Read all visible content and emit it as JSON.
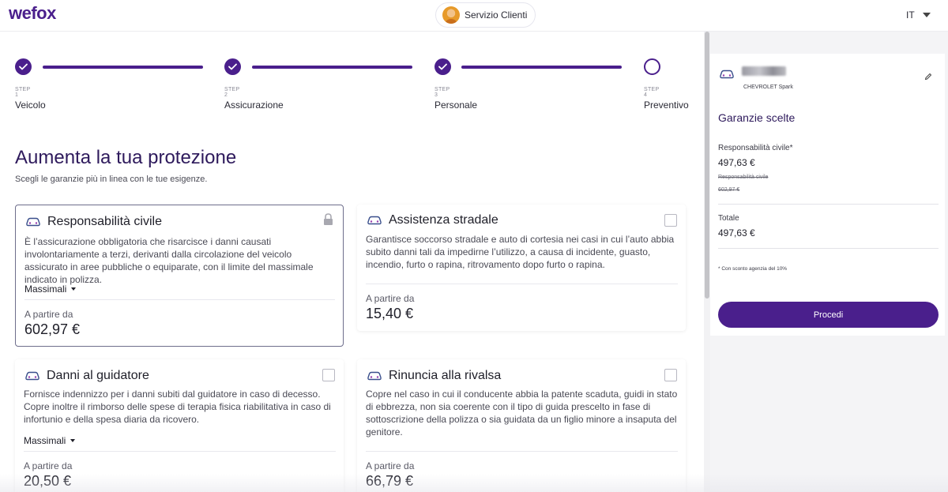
{
  "header": {
    "logo": "wefox",
    "support_label": "Servizio Clienti",
    "language": "IT"
  },
  "stepper": {
    "steps": [
      {
        "number": "STEP 1",
        "label": "Veicolo",
        "done": true
      },
      {
        "number": "STEP 2",
        "label": "Assicurazione",
        "done": true
      },
      {
        "number": "STEP 3",
        "label": "Personale",
        "done": true
      },
      {
        "number": "STEP 4",
        "label": "Preventivo",
        "done": false
      }
    ]
  },
  "main": {
    "title": "Aumenta la tua protezione",
    "subtitle": "Scegli le garanzie più in linea con le tue esigenze.",
    "from_label": "A partire da",
    "massimali_label": "Massimali",
    "cards": [
      {
        "title": "Responsabilità civile",
        "description": "È l’assicurazione obbligatoria che risarcisce i danni causati involontariamente a terzi, derivanti dalla circolazione del veicolo assicurato in aree pubbliche o equiparate, con il limite del massimale indicato in polizza.",
        "price": "602,97 €",
        "locked": true
      },
      {
        "title": "Assistenza stradale",
        "description": "Garantisce soccorso stradale e auto di cortesia nei casi in cui l’auto abbia subito danni tali da impedirne l’utilizzo, a causa di incidente, guasto, incendio, furto o rapina, ritrovamento dopo furto o rapina.",
        "price": "15,40 €",
        "locked": false
      },
      {
        "title": "Danni al guidatore",
        "description": "Fornisce indennizzo per i danni subiti dal guidatore in caso di decesso. Copre inoltre il rimborso delle spese di terapia fisica riabilitativa in caso di infortunio e della spesa diaria da ricovero.",
        "price": "20,50 €",
        "locked": false
      },
      {
        "title": "Rinuncia alla rivalsa",
        "description": "Copre nel caso in cui il conducente abbia la patente scaduta, guidi in stato di ebbrezza, non sia coerente con il tipo di guida prescelto in fase di sottoscrizione della polizza o sia guidata da un figlio minore a insaputa del genitore.",
        "price": "66,79 €",
        "locked": false
      }
    ]
  },
  "sidebar": {
    "vehicle_model": "CHEVROLET Spark",
    "title": "Garanzie scelte",
    "item_label": "Responsabilità civile*",
    "item_value": "497,63 €",
    "original_label": "Responsabilità civile",
    "original_value": "602,97 €",
    "total_label": "Totale",
    "total_value": "497,63 €",
    "note": "* Con sconto agenzia del 10%",
    "proceed_label": "Procedi"
  },
  "colors": {
    "brand": "#4a1f8c",
    "title": "#2e1a5c",
    "panel_bg": "#f4f4f6"
  }
}
